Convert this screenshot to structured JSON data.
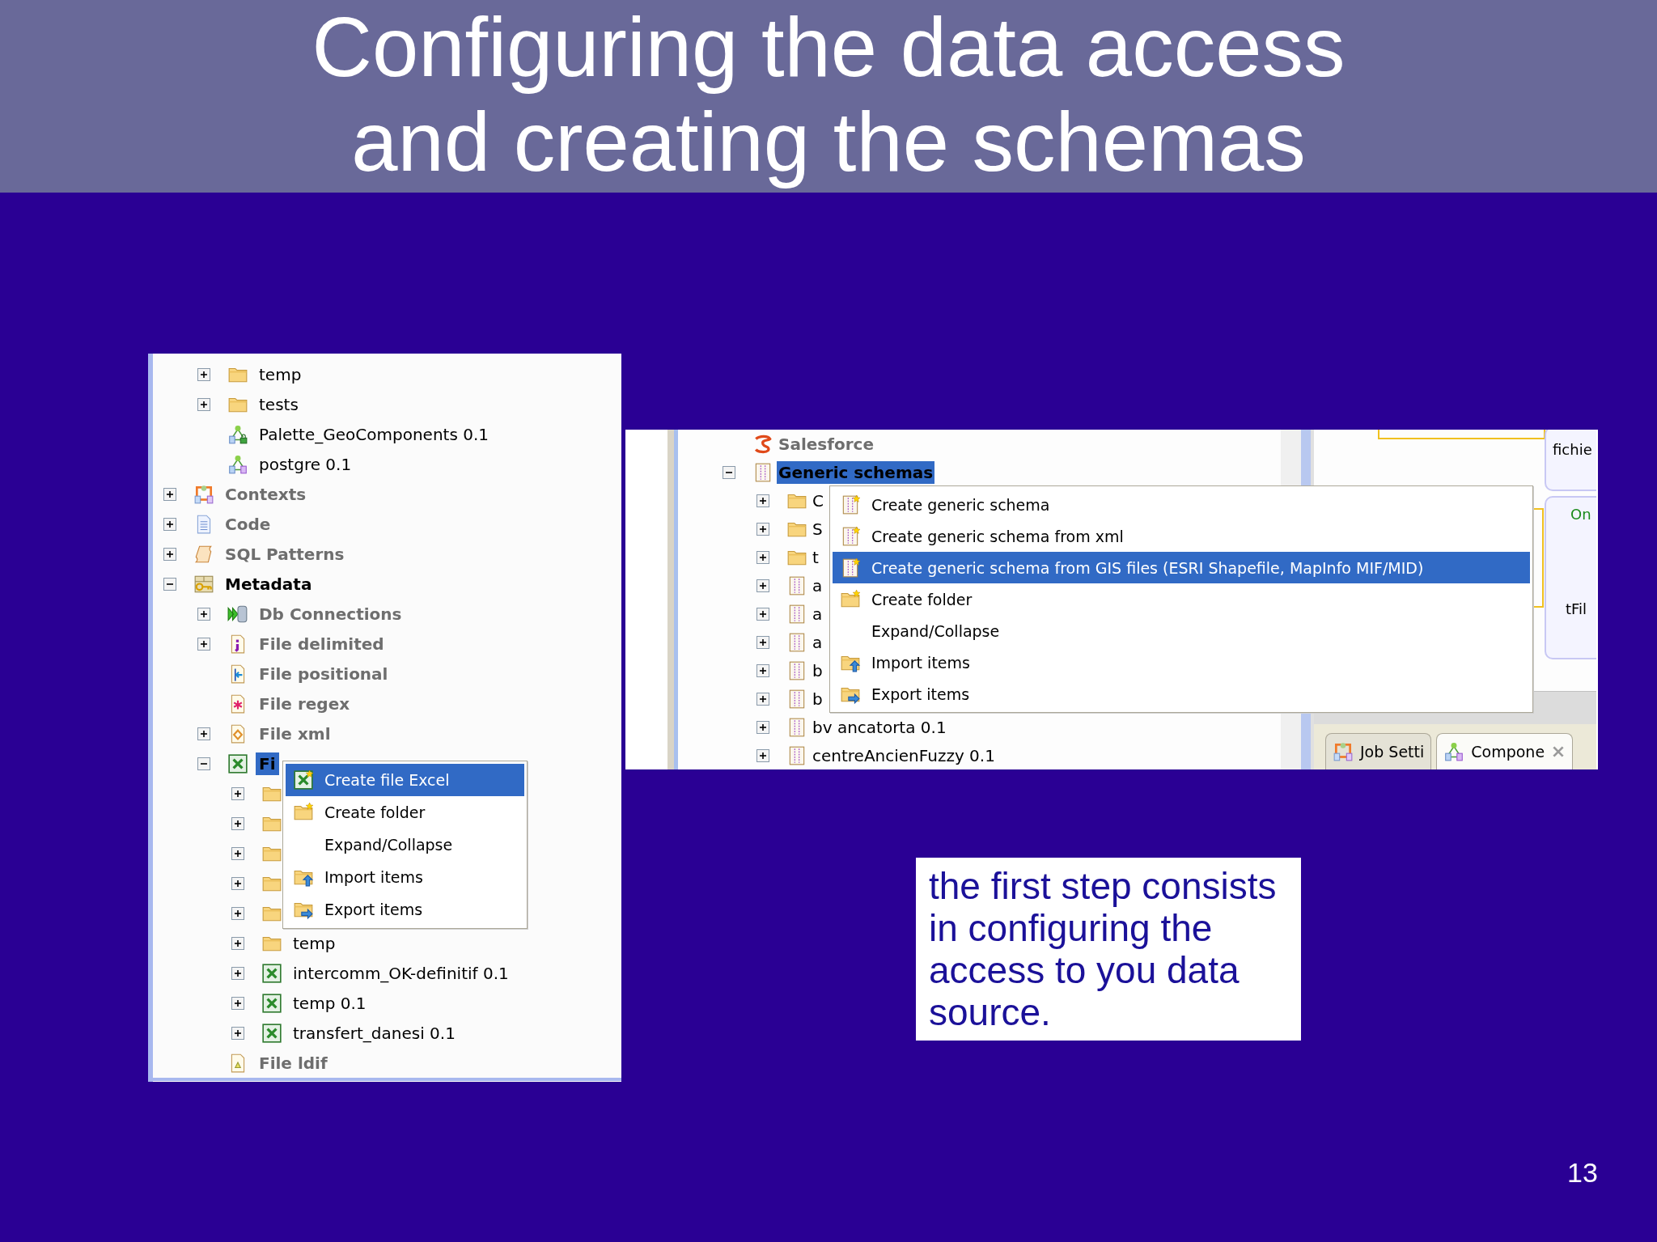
{
  "title_lines": [
    "Configuring the data access",
    "and creating the schemas"
  ],
  "left_screenshot": {
    "tree": [
      {
        "kind": "offscreen",
        "children": [
          {
            "label": "temp",
            "kind": "folder",
            "expanded": false,
            "selected": false
          },
          {
            "label": "tests",
            "kind": "folder",
            "expanded": false,
            "selected": false
          },
          {
            "label": "Palette_GeoComponents 0.1",
            "kind": "locked-job",
            "selected": false
          },
          {
            "label": "postgre 0.1",
            "kind": "job",
            "selected": false
          }
        ]
      },
      {
        "label": "Contexts",
        "kind": "contexts",
        "expanded": false,
        "selected": false
      },
      {
        "label": "Code",
        "kind": "code",
        "expanded": false,
        "selected": false
      },
      {
        "label": "SQL Patterns",
        "kind": "sql-patterns",
        "expanded": false,
        "selected": false
      },
      {
        "label": "Metadata",
        "kind": "metadata",
        "expanded": true,
        "selected": false,
        "children": [
          {
            "label": "Db Connections",
            "kind": "db-connections",
            "expanded": false,
            "selected": false
          },
          {
            "label": "File delimited",
            "kind": "delimited-files",
            "expanded": false,
            "selected": false
          },
          {
            "label": "File positional",
            "kind": "positional-files",
            "selected": false
          },
          {
            "label": "File regex",
            "kind": "regex-files",
            "selected": false
          },
          {
            "label": "File xml",
            "kind": "xml-files",
            "expanded": false,
            "selected": false
          },
          {
            "label": "Fi",
            "kind": "excel-files",
            "expanded": true,
            "selected": true,
            "children": [
              {
                "kind": "folder",
                "expanded": false,
                "selected": false
              },
              {
                "kind": "folder",
                "expanded": false,
                "selected": false
              },
              {
                "kind": "folder",
                "expanded": false,
                "selected": false
              },
              {
                "kind": "folder",
                "expanded": false,
                "selected": false
              },
              {
                "kind": "folder",
                "expanded": false,
                "selected": false
              },
              {
                "label": "temp",
                "kind": "folder",
                "expanded": false,
                "selected": false
              },
              {
                "label": "intercomm_OK-definitif 0.1",
                "kind": "excel-file",
                "expanded": false,
                "selected": false
              },
              {
                "label": "temp 0.1",
                "kind": "excel-file",
                "expanded": false,
                "selected": false
              },
              {
                "label": "transfert_danesi 0.1",
                "kind": "excel-file",
                "expanded": false,
                "selected": false
              }
            ]
          },
          {
            "label": "File ldif",
            "kind": "ldif-files",
            "selected": false
          }
        ]
      }
    ],
    "context_menu": [
      {
        "label": "Create file Excel",
        "kind": "create-excel",
        "selected": true
      },
      {
        "label": "Create folder",
        "kind": "create-folder",
        "selected": false
      },
      {
        "label": "Expand/Collapse",
        "kind": "expand",
        "selected": false
      },
      {
        "label": "Import items",
        "kind": "import",
        "selected": false
      },
      {
        "label": "Export items",
        "kind": "export",
        "selected": false
      }
    ]
  },
  "right_screenshot": {
    "tree": [
      {
        "kind": "offscreen",
        "children": [
          {
            "label": "Salesforce",
            "kind": "salesforce",
            "selected": false
          },
          {
            "label": "Generic schemas",
            "kind": "generic-schemas",
            "expanded": true,
            "selected": true,
            "children": [
              {
                "label": "C",
                "kind": "folder",
                "expanded": false,
                "selected": false
              },
              {
                "label": "S",
                "kind": "folder",
                "expanded": false,
                "selected": false
              },
              {
                "label": "t",
                "kind": "folder",
                "expanded": false,
                "selected": false
              },
              {
                "label": "a",
                "kind": "schema",
                "expanded": false,
                "selected": false
              },
              {
                "label": "a",
                "kind": "schema",
                "expanded": false,
                "selected": false
              },
              {
                "label": "a",
                "kind": "schema",
                "expanded": false,
                "selected": false
              },
              {
                "label": "b",
                "kind": "schema",
                "expanded": false,
                "selected": false
              },
              {
                "label": "b",
                "kind": "schema",
                "expanded": false,
                "selected": false
              },
              {
                "label": "bv ancatorta 0.1",
                "kind": "schema",
                "expanded": false,
                "selected": false
              },
              {
                "label": "centreAncienFuzzy 0.1",
                "kind": "schema",
                "expanded": false,
                "selected": false
              }
            ]
          }
        ]
      }
    ],
    "context_menu": [
      {
        "label": "Create generic schema",
        "kind": "create-schema",
        "selected": false
      },
      {
        "label": "Create generic schema from xml",
        "kind": "create-schema",
        "selected": false
      },
      {
        "label": "Create generic schema from GIS files (ESRI Shapefile, MapInfo MIF/MID)",
        "kind": "create-schema",
        "selected": true
      },
      {
        "label": "Create folder",
        "kind": "create-folder",
        "selected": false
      },
      {
        "label": "Expand/Collapse",
        "kind": "expand",
        "selected": false
      },
      {
        "label": "Import items",
        "kind": "import",
        "selected": false
      },
      {
        "label": "Export items",
        "kind": "export",
        "selected": false
      }
    ],
    "designer": {
      "boxes": [
        {
          "texts": [
            {
              "text": "fichie",
              "kind": "name"
            }
          ]
        },
        {
          "texts": [
            {
              "text": "On",
              "kind": "link"
            },
            {
              "text": "tFil",
              "kind": "name"
            }
          ]
        }
      ]
    },
    "tabs": [
      {
        "label": "Job Setti",
        "kind": "job-settings",
        "selected": false
      },
      {
        "label": "Compone",
        "kind": "components",
        "selected": true
      }
    ]
  },
  "note": "the first step consists in configuring the access to you data source.",
  "page_number": "13"
}
